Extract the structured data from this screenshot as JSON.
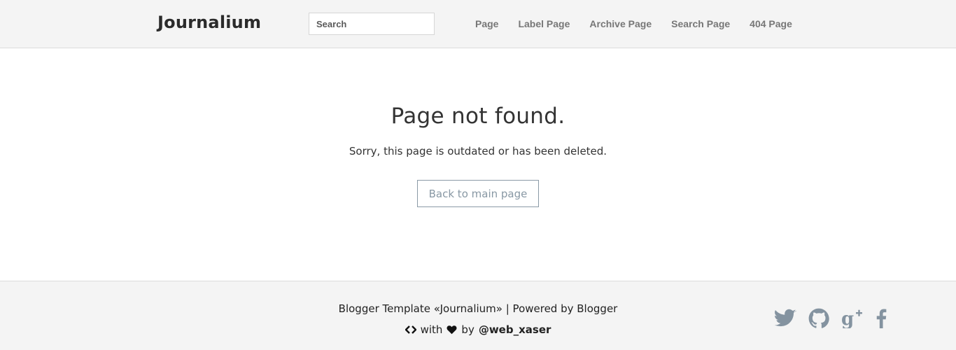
{
  "header": {
    "logo": "Journalium",
    "search": {
      "placeholder": "Search",
      "value": ""
    },
    "nav": [
      {
        "label": "Page"
      },
      {
        "label": "Label Page"
      },
      {
        "label": "Archive Page"
      },
      {
        "label": "Search Page"
      },
      {
        "label": "404 Page"
      }
    ]
  },
  "main": {
    "title": "Page not found.",
    "subtitle": "Sorry, this page is outdated or has been deleted.",
    "back_button": "Back to main page"
  },
  "footer": {
    "line1": "Blogger Template «Journalium» | Powered by Blogger",
    "with_text": "with",
    "by_text": "by",
    "author": "@web_xaser",
    "social_icons": [
      "twitter-icon",
      "github-icon",
      "google-plus-icon",
      "facebook-icon"
    ]
  },
  "colors": {
    "header_bg": "#f4f4f4",
    "footer_bg": "#f4f4f4",
    "nav_text": "#777777",
    "button_border": "#8a9aa6",
    "icon_color": "#8493a0"
  }
}
